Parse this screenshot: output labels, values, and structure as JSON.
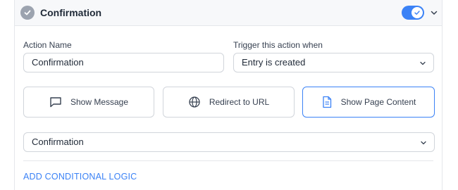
{
  "header": {
    "title": "Confirmation",
    "toggle_on": true
  },
  "form": {
    "action_name_label": "Action Name",
    "action_name_value": "Confirmation",
    "trigger_label": "Trigger this action when",
    "trigger_value": "Entry is created",
    "action_types": [
      {
        "label": "Show Message",
        "icon": "chat-bubble-icon",
        "selected": false
      },
      {
        "label": "Redirect to URL",
        "icon": "globe-icon",
        "selected": false
      },
      {
        "label": "Show Page Content",
        "icon": "document-icon",
        "selected": true
      }
    ],
    "page_select_value": "Confirmation",
    "conditional_link": "ADD CONDITIONAL LOGIC"
  },
  "colors": {
    "accent": "#3b82f6",
    "check_gray": "#9ca3af",
    "header_bg": "#f7f8fa"
  }
}
